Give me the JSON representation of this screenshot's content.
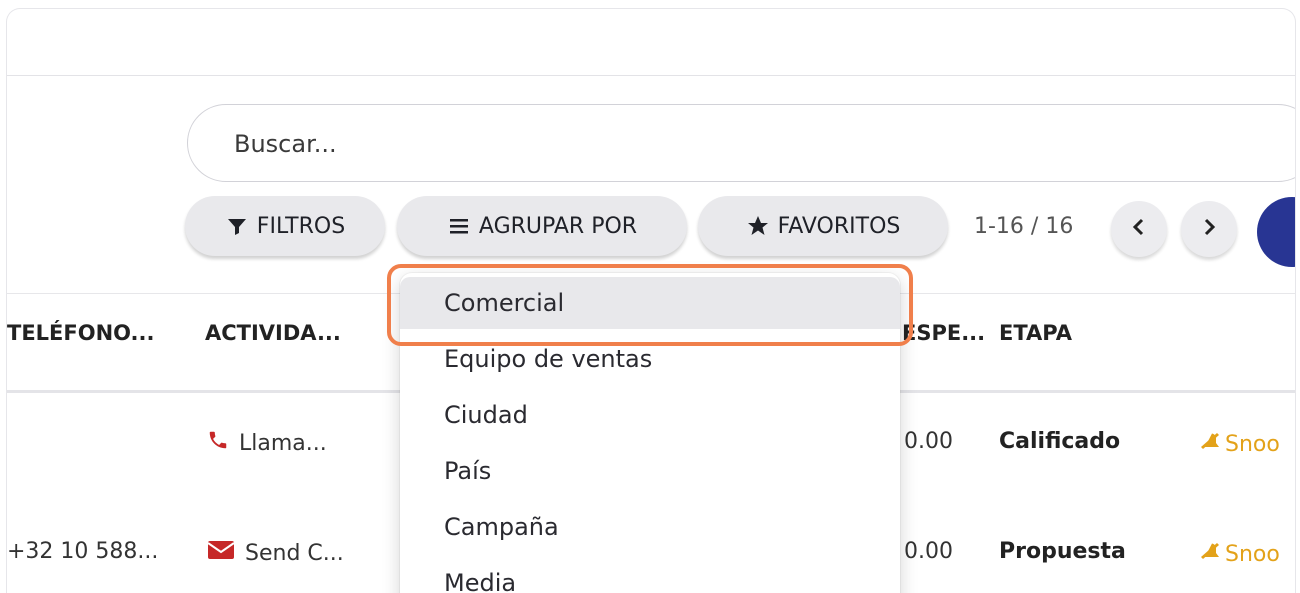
{
  "search": {
    "placeholder": "Buscar..."
  },
  "filters": {
    "filtros_label": "FILTROS",
    "agrupar_label": "AGRUPAR POR",
    "favoritos_label": "FAVORITOS"
  },
  "pager": {
    "range": "1-16 / 16"
  },
  "table": {
    "columns": [
      "TELÉFONO...",
      "ACTIVIDA...",
      "ESPE...",
      "ETAPA"
    ],
    "rows": [
      {
        "telefono": "",
        "actividad": "Llama...",
        "actividad_icon": "phone-icon",
        "esperado": "0.00",
        "etapa": "Calificado",
        "snooze": "Snoo"
      },
      {
        "telefono": "+32 10 588...",
        "actividad": "Send C...",
        "actividad_icon": "envelope-icon",
        "esperado": "0.00",
        "etapa": "Propuesta",
        "snooze": "Snoo"
      }
    ]
  },
  "groupby_menu": {
    "items": [
      "Comercial",
      "Equipo de ventas",
      "Ciudad",
      "País",
      "Campaña",
      "Media"
    ],
    "highlighted": "Comercial"
  },
  "colors": {
    "accent_dark_blue": "#283593",
    "highlight_orange": "#f07f4b",
    "activity_red": "#c62828",
    "snooze_yellow": "#e3a21a"
  }
}
